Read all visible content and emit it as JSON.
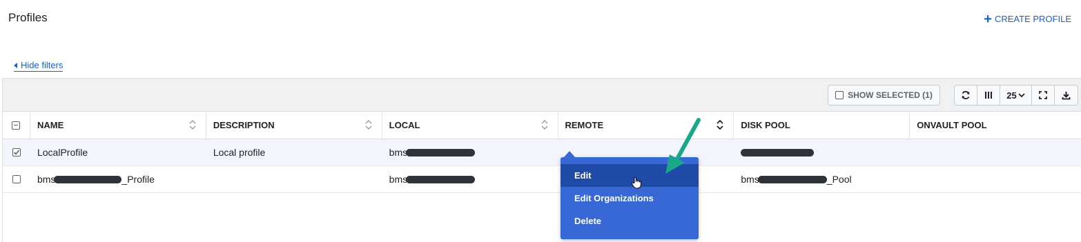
{
  "header": {
    "title": "Profiles",
    "create_label": "CREATE PROFILE",
    "hide_filters_label": "Hide filters"
  },
  "toolbar": {
    "show_selected_label": "SHOW SELECTED (1)",
    "page_size": "25",
    "icons": [
      "refresh-icon",
      "columns-icon",
      "fullscreen-icon",
      "download-icon"
    ]
  },
  "table": {
    "columns": [
      "NAME",
      "DESCRIPTION",
      "LOCAL",
      "REMOTE",
      "DISK POOL",
      "ONVAULT POOL"
    ],
    "rows": [
      {
        "selected": true,
        "name": "LocalProfile",
        "description": "Local profile",
        "local_prefix": "bms",
        "remote": "",
        "disk_pool_prefix": "",
        "disk_pool_suffix": "",
        "onvault": ""
      },
      {
        "selected": false,
        "name_prefix": "bms",
        "name_suffix": "_Profile",
        "description": "",
        "local_prefix": "bms",
        "remote": "",
        "disk_pool_prefix": "bms",
        "disk_pool_suffix": "_Pool",
        "onvault": ""
      }
    ]
  },
  "context_menu": {
    "items": [
      "Edit",
      "Edit Organizations",
      "Delete"
    ]
  },
  "colors": {
    "accent": "#1a5fc4",
    "menu_bg": "#3768d6",
    "menu_active": "#1f4aa8",
    "annotation_arrow": "#1aa88a"
  }
}
